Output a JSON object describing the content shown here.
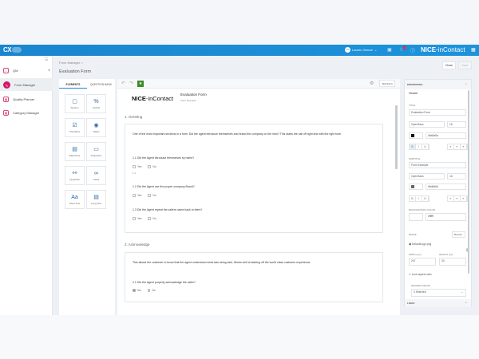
{
  "header": {
    "app_logo": "CX",
    "user_name": "Lauren Gerner",
    "user_initials": "LG",
    "notification_count": "4",
    "brand": {
      "nice": "NICE",
      "incontact": "inContact"
    },
    "colors": {
      "bar": "#1a8fd6",
      "accent": "#d6176a"
    }
  },
  "sidebar": {
    "items": [
      {
        "label": "QM",
        "icon": "qm-icon"
      },
      {
        "label": "Form Manager",
        "icon": "form-manager-icon"
      },
      {
        "label": "Quality Planner",
        "icon": "quality-planner-icon"
      },
      {
        "label": "Category Manager",
        "icon": "category-manager-icon"
      }
    ]
  },
  "page": {
    "breadcrumb": "Form Manager >",
    "title": "Evaluation Form",
    "close_label": "Close",
    "save_label": "Save"
  },
  "elements": {
    "tabs": [
      "ELEMENTS",
      "QUESTION BANK"
    ],
    "items": [
      {
        "label": "Section",
        "icon": "▢"
      },
      {
        "label": "Yes/No",
        "icon": "%"
      },
      {
        "label": "Checkbox",
        "icon": "☑"
      },
      {
        "label": "Radio",
        "icon": "◉"
      },
      {
        "label": "Date/Time",
        "icon": "▤"
      },
      {
        "label": "Dropdown",
        "icon": "▭"
      },
      {
        "label": "Hyperlink",
        "icon": "⚯"
      },
      {
        "label": "Label",
        "icon": "∞"
      },
      {
        "label": "Short Text",
        "icon": "Aa"
      },
      {
        "label": "Long Text",
        "icon": "▤"
      }
    ]
  },
  "canvas": {
    "test_form_label": "Test Form",
    "form_logo": {
      "nice": "NICE",
      "incontact": "inContact"
    },
    "form_title": "Evaluation Form",
    "form_subtitle": "Form Example",
    "sections": [
      {
        "title": "1. Greeting",
        "description": "One of the most important sections in a form. Did the agent introduce themselves and brand the company on the intro? This starts the call off right and with the right tone.",
        "questions": [
          {
            "text": "1.1 Did the Agent introduce themselves by name?",
            "options": [
              "Yes",
              "No"
            ],
            "note": "1.1"
          },
          {
            "text": "1.2 Did the Agent use the proper company Brand?",
            "options": [
              "Yes",
              "No"
            ]
          },
          {
            "text": "1.3 Did the Agent repeat the callers name back to them?",
            "options": [
              "Yes",
              "No"
            ]
          }
        ]
      },
      {
        "title": "2. Acknowledge",
        "description": "This allows the customer to know that the agent understood what was being said. Works well at starting off the world class customer experience.",
        "questions": [
          {
            "text": "2.1 Did the Agent properly acknowledge the caller?",
            "options": [
              "Yes",
              "No"
            ]
          }
        ]
      }
    ]
  },
  "properties": {
    "heading": "PROPERTIES",
    "section": "Header",
    "title_label": "TITLE",
    "title_value": "Evaluation Form",
    "font": "OpenSans",
    "size": "16",
    "title_color": "#5a5a5a",
    "subtitle_label": "SUBTITLE",
    "subtitle_value": "Form Example",
    "subtitle_color": "#6d6d6d",
    "bg_label": "BACKGROUND COLOR",
    "bg_value": "#ffffff",
    "image_label": "IMAGE",
    "browse_label": "Browse",
    "image_file": "DefaultLogo.png",
    "width_label": "WIDTH (px)",
    "width_value": "247",
    "height_label": "HEIGHT (px)",
    "height_value": "30",
    "lock_label": "Lock aspect ratio",
    "lock_checked": true,
    "header_fields_label": "HEADER FIELDS",
    "header_fields_value": "0 Selected",
    "logic_heading": "LOGIC"
  }
}
